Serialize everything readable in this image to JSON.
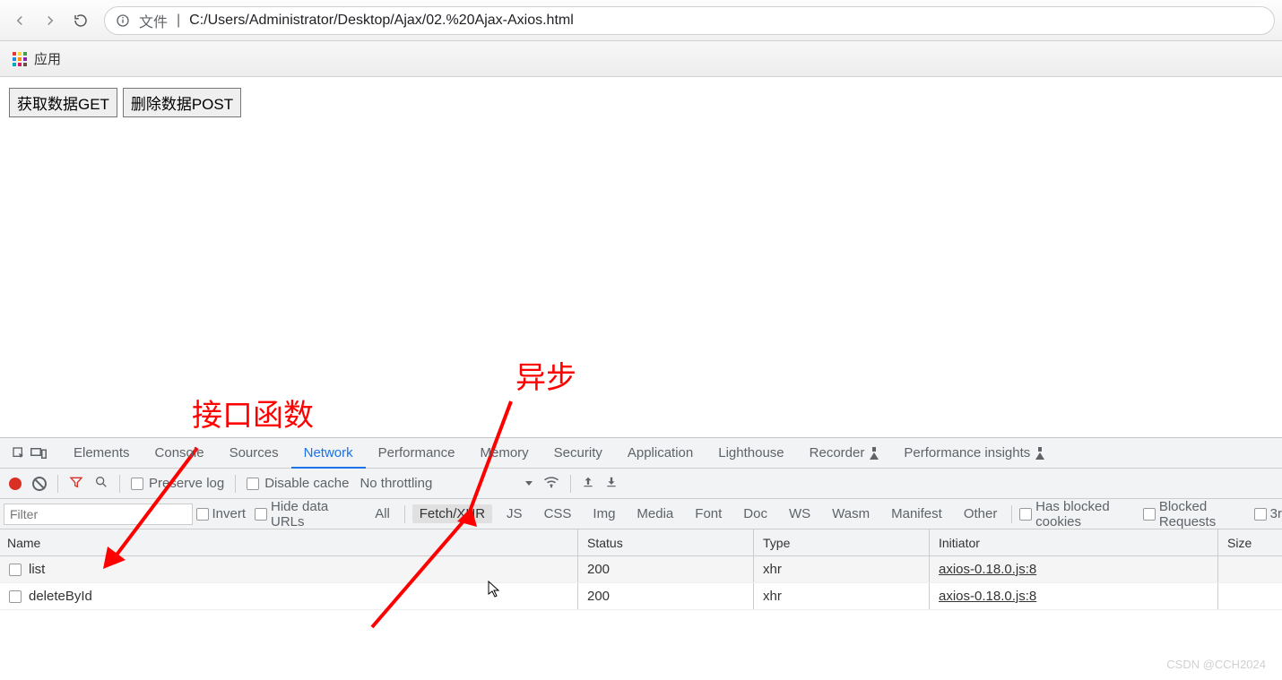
{
  "chrome": {
    "file_label": "文件",
    "url": "C:/Users/Administrator/Desktop/Ajax/02.%20Ajax-Axios.html",
    "apps_label": "应用"
  },
  "page": {
    "get_button": "获取数据GET",
    "post_button": "删除数据POST"
  },
  "annotations": {
    "async": "异步",
    "api_func": "接口函数"
  },
  "devtools": {
    "tabs": {
      "elements": "Elements",
      "console": "Console",
      "sources": "Sources",
      "network": "Network",
      "performance": "Performance",
      "memory": "Memory",
      "security": "Security",
      "application": "Application",
      "lighthouse": "Lighthouse",
      "recorder": "Recorder",
      "perf_insights": "Performance insights"
    },
    "toolbar": {
      "preserve_log": "Preserve log",
      "disable_cache": "Disable cache",
      "throttling": "No throttling"
    },
    "filters": {
      "placeholder": "Filter",
      "invert": "Invert",
      "hide_data_urls": "Hide data URLs",
      "all": "All",
      "fetch_xhr": "Fetch/XHR",
      "js": "JS",
      "css": "CSS",
      "img": "Img",
      "media": "Media",
      "font": "Font",
      "doc": "Doc",
      "ws": "WS",
      "wasm": "Wasm",
      "manifest": "Manifest",
      "other": "Other",
      "blocked_cookies": "Has blocked cookies",
      "blocked_requests": "Blocked Requests",
      "third_party": "3r"
    },
    "headers": {
      "name": "Name",
      "status": "Status",
      "type": "Type",
      "initiator": "Initiator",
      "size": "Size"
    },
    "rows": [
      {
        "name": "list",
        "status": "200",
        "type": "xhr",
        "initiator": "axios-0.18.0.js:8"
      },
      {
        "name": "deleteById",
        "status": "200",
        "type": "xhr",
        "initiator": "axios-0.18.0.js:8"
      }
    ]
  },
  "watermark": "CSDN @CCH2024"
}
